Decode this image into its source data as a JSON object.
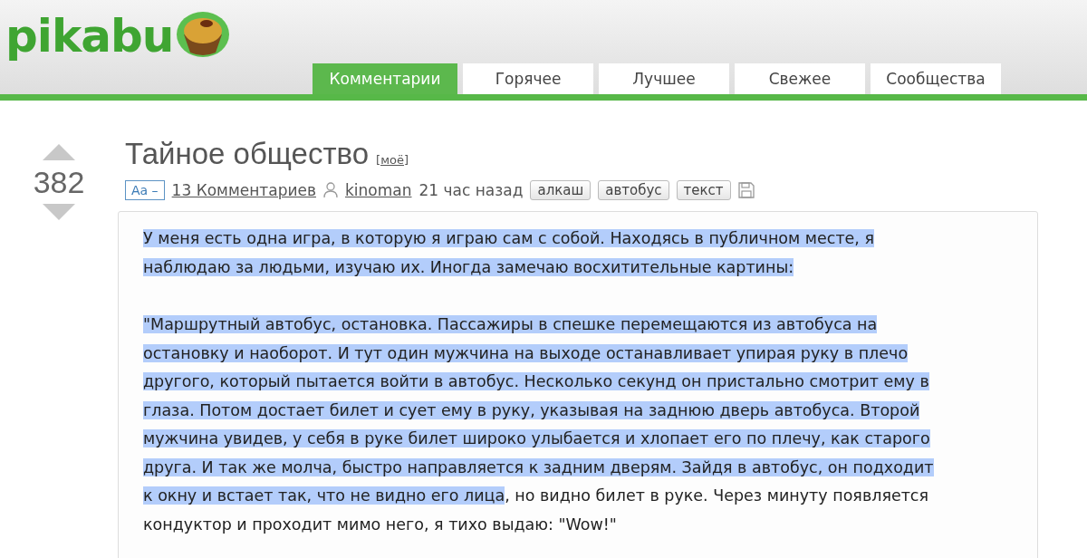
{
  "header": {
    "logo": "pikabu",
    "tabs": [
      {
        "label": "Комментарии",
        "selected": true
      },
      {
        "label": "Горячее",
        "selected": false
      },
      {
        "label": "Лучшее",
        "selected": false
      },
      {
        "label": "Свежее",
        "selected": false
      },
      {
        "label": "Сообщества",
        "selected": false
      }
    ]
  },
  "post": {
    "score": "382",
    "title": "Тайное общество",
    "title_tag": "[моё]",
    "font_toggle": "Аа –",
    "comments_link": "13 Комментариев",
    "author": "kinoman",
    "time": "21 час назад",
    "tags": [
      "алкаш",
      "автобус",
      "текст"
    ],
    "paragraphs": [
      [
        [
          {
            "text": "У меня есть одна игра, в которую я играю сам с собой. Находясь в публичном месте, я",
            "selected": true
          }
        ],
        [
          {
            "text": "наблюдаю за людьми, изучаю их. Иногда замечаю восхитительные картины:",
            "selected": true
          }
        ]
      ],
      [
        [
          {
            "text": "\"Маршрутный автобус, остановка. Пассажиры в спешке перемещаются из автобуса на",
            "selected": true
          }
        ],
        [
          {
            "text": "остановку и наоборот. И тут один мужчина на выходе останавливает упирая руку в плечо",
            "selected": true
          }
        ],
        [
          {
            "text": "другого, который пытается войти в автобус. Несколько секунд он пристально смотрит ему в",
            "selected": true
          }
        ],
        [
          {
            "text": "глаза. Потом достает билет и сует ему в руку, указывая на заднюю дверь автобуса. Второй",
            "selected": true
          }
        ],
        [
          {
            "text": "мужчина увидев, у себя в руке билет широко улыбается и хлопает его по плечу, как старого",
            "selected": true
          }
        ],
        [
          {
            "text": "друга. И так же молча, быстро направляется к задним дверям. Зайдя в автобус, он подходит",
            "selected": true
          }
        ],
        [
          {
            "text": "к окну и встает так, что не видно его лица",
            "selected": true
          },
          {
            "text": ", но видно билет в руке. Через минуту появляется",
            "selected": false
          }
        ],
        [
          {
            "text": "кондуктор и проходит мимо него, я тихо выдаю: \"Wow!\"",
            "selected": false
          }
        ]
      ]
    ]
  }
}
